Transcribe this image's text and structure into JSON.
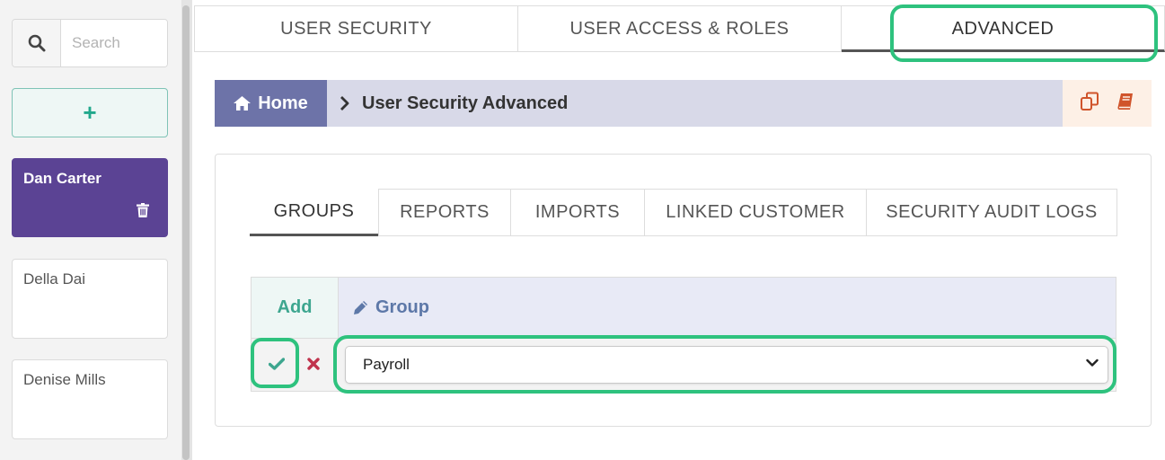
{
  "sidebar": {
    "search_placeholder": "Search",
    "add_label": "+",
    "users": [
      {
        "name": "Dan Carter",
        "active": true
      },
      {
        "name": "Della Dai",
        "active": false
      },
      {
        "name": "Denise Mills",
        "active": false
      }
    ]
  },
  "top_tabs": [
    {
      "label": "USER SECURITY",
      "active": false
    },
    {
      "label": "USER ACCESS & ROLES",
      "active": false
    },
    {
      "label": "ADVANCED",
      "active": true
    }
  ],
  "breadcrumb": {
    "home": "Home",
    "current": "User Security Advanced"
  },
  "sub_tabs": [
    {
      "label": "GROUPS",
      "active": true
    },
    {
      "label": "REPORTS",
      "active": false
    },
    {
      "label": "IMPORTS",
      "active": false
    },
    {
      "label": "LINKED CUSTOMER",
      "active": false
    },
    {
      "label": "SECURITY AUDIT LOGS",
      "active": false
    }
  ],
  "grid": {
    "col_add": "Add",
    "col_group": "Group",
    "row": {
      "group_value": "Payroll"
    }
  },
  "colors": {
    "accent_purple": "#5b4394",
    "highlight_green": "#2ec27e",
    "confirm_teal": "#3da68f",
    "cancel_red": "#c0334d",
    "crumb_home": "#6d73a8"
  }
}
